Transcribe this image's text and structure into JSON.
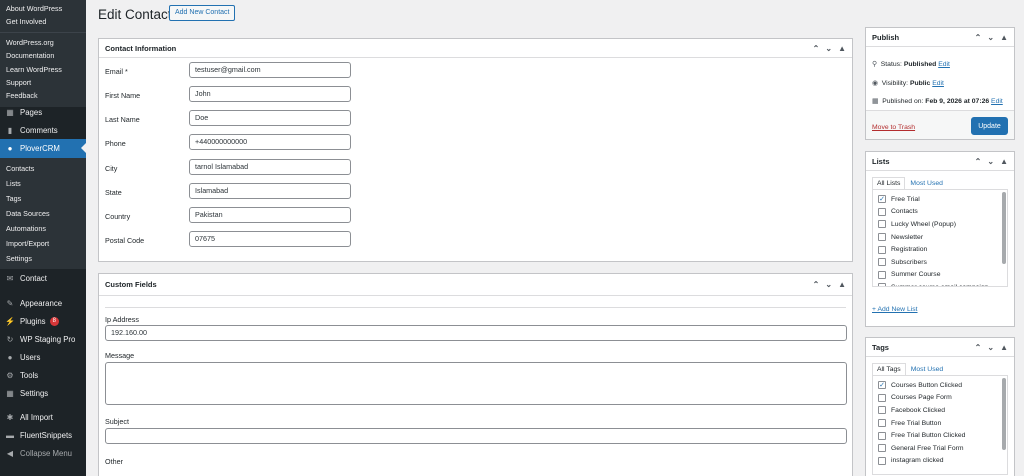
{
  "sidebar": {
    "top_links": [
      "About WordPress",
      "Get Involved"
    ],
    "wp_links": [
      "WordPress.org",
      "Documentation",
      "Learn WordPress",
      "Support",
      "Feedback"
    ],
    "pages": "Pages",
    "comments": "Comments",
    "plovercrm": "PloverCRM",
    "crm_sub": [
      "Contacts",
      "Lists",
      "Tags",
      "Data Sources",
      "Automations",
      "Import/Export",
      "Settings"
    ],
    "contact": "Contact",
    "appearance": "Appearance",
    "plugins": "Plugins",
    "plugins_badge": "8",
    "wpstaging": "WP Staging Pro",
    "users": "Users",
    "tools": "Tools",
    "settings": "Settings",
    "allimport": "All Import",
    "fluentsnippets": "FluentSnippets",
    "collapse": "Collapse Menu"
  },
  "page": {
    "title": "Edit Contact",
    "add_new": "Add New Contact"
  },
  "contact_info": {
    "title": "Contact Information",
    "fields": [
      {
        "label": "Email *",
        "value": "testuser@gmail.com"
      },
      {
        "label": "First Name",
        "value": "John"
      },
      {
        "label": "Last Name",
        "value": "Doe"
      },
      {
        "label": "Phone",
        "value": "+440000000000"
      },
      {
        "label": "City",
        "value": "tarnol Islamabad"
      },
      {
        "label": "State",
        "value": "Islamabad"
      },
      {
        "label": "Country",
        "value": "Pakistan"
      },
      {
        "label": "Postal Code",
        "value": "07675"
      }
    ]
  },
  "custom_fields": {
    "title": "Custom Fields",
    "ip_label": "Ip Address",
    "ip_value": "192.160.00",
    "message_label": "Message",
    "subject_label": "Subject",
    "other_label": "Other"
  },
  "publish": {
    "title": "Publish",
    "status_label": "Status:",
    "status_value": "Published",
    "visibility_label": "Visibility:",
    "visibility_value": "Public",
    "published_label": "Published on:",
    "published_value": "Feb 9, 2026 at 07:26",
    "edit": "Edit",
    "trash": "Move to Trash",
    "update": "Update"
  },
  "lists": {
    "title": "Lists",
    "tab_all": "All Lists",
    "tab_most": "Most Used",
    "items": [
      {
        "label": "Free Trial",
        "checked": true
      },
      {
        "label": "Contacts",
        "checked": false
      },
      {
        "label": "Lucky Wheel (Popup)",
        "checked": false
      },
      {
        "label": "Newsletter",
        "checked": false
      },
      {
        "label": "Registration",
        "checked": false
      },
      {
        "label": "Subscribers",
        "checked": false
      },
      {
        "label": "Summer Course",
        "checked": false
      },
      {
        "label": "Summer course email campaign",
        "checked": false
      }
    ],
    "add_new": "+ Add New List"
  },
  "tags": {
    "title": "Tags",
    "tab_all": "All Tags",
    "tab_most": "Most Used",
    "items": [
      {
        "label": "Courses Button Clicked",
        "checked": true
      },
      {
        "label": "Courses Page Form",
        "checked": false
      },
      {
        "label": "Facebook Clicked",
        "checked": false
      },
      {
        "label": "Free Trial Button",
        "checked": false
      },
      {
        "label": "Free Trial Button Clicked",
        "checked": false
      },
      {
        "label": "General Free Trial Form",
        "checked": false
      },
      {
        "label": "instagram clicked",
        "checked": false
      }
    ]
  }
}
